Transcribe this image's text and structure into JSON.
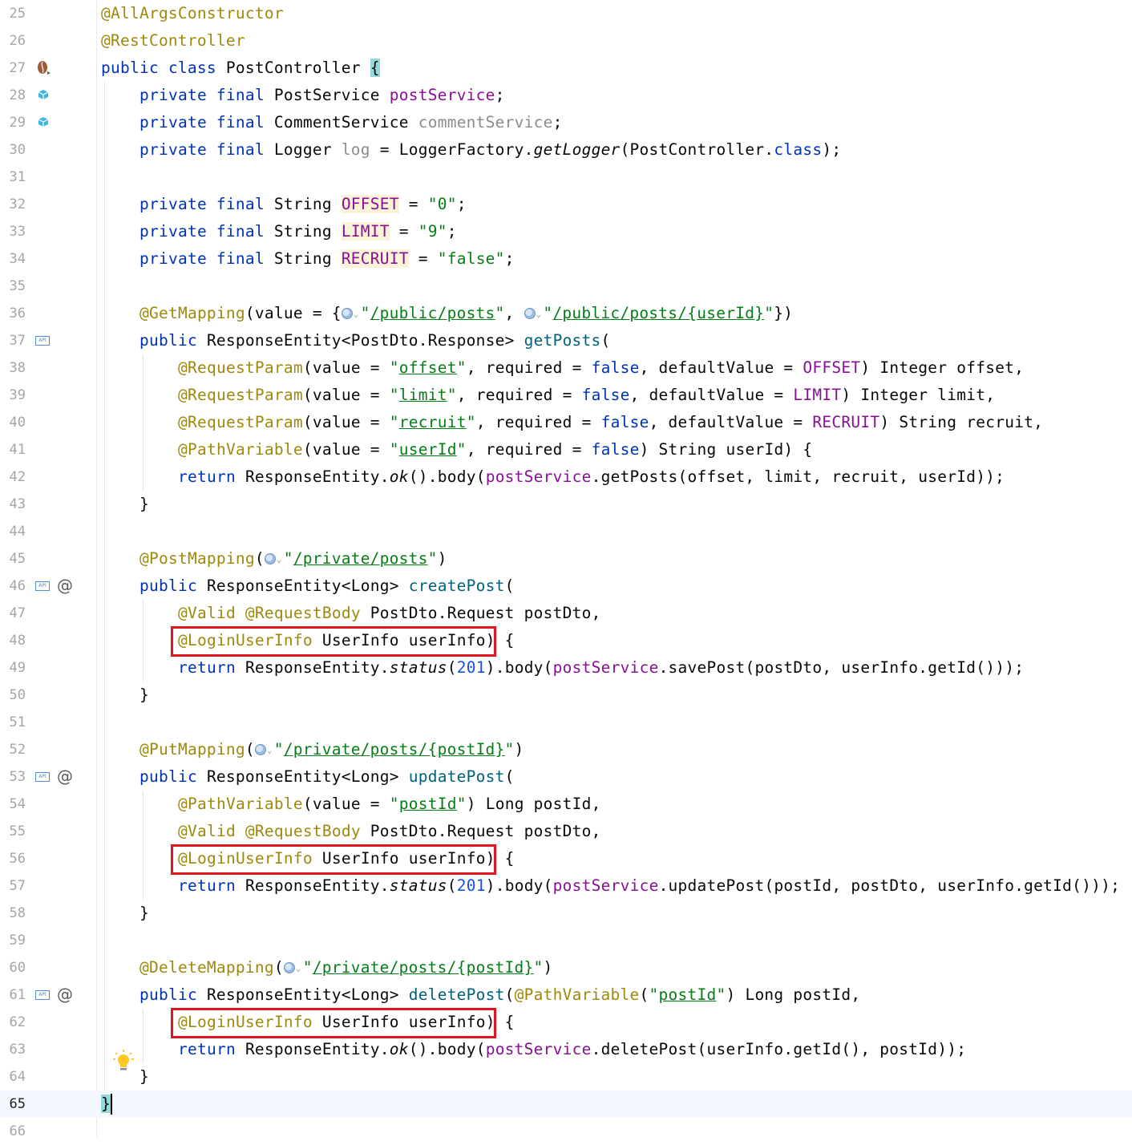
{
  "editor": {
    "lines": [
      {
        "num": "25",
        "indent": 0,
        "tokens": [
          {
            "t": "@AllArgsConstructor",
            "c": "anno"
          }
        ]
      },
      {
        "num": "26",
        "indent": 0,
        "tokens": [
          {
            "t": "@RestController",
            "c": "anno"
          }
        ]
      },
      {
        "num": "27",
        "indent": 0,
        "gutter": "coffee-icon",
        "tokens": [
          {
            "t": "public ",
            "c": "kw"
          },
          {
            "t": "class ",
            "c": "kw"
          },
          {
            "t": "PostController "
          },
          {
            "t": "{",
            "c": "bracehl"
          }
        ]
      },
      {
        "num": "28",
        "indent": 1,
        "gutter": "bean-icon",
        "tokens": [
          {
            "t": "private ",
            "c": "kw"
          },
          {
            "t": "final ",
            "c": "kw"
          },
          {
            "t": "PostService "
          },
          {
            "t": "postService",
            "c": "field"
          },
          {
            "t": ";"
          }
        ]
      },
      {
        "num": "29",
        "indent": 1,
        "gutter": "bean-icon",
        "tokens": [
          {
            "t": "private ",
            "c": "kw"
          },
          {
            "t": "final ",
            "c": "kw"
          },
          {
            "t": "CommentService "
          },
          {
            "t": "commentService",
            "c": "gray"
          },
          {
            "t": ";"
          }
        ]
      },
      {
        "num": "30",
        "indent": 1,
        "tokens": [
          {
            "t": "private ",
            "c": "kw"
          },
          {
            "t": "final ",
            "c": "kw"
          },
          {
            "t": "Logger "
          },
          {
            "t": "log",
            "c": "gray"
          },
          {
            "t": " = LoggerFactory."
          },
          {
            "t": "getLogger",
            "c": "it"
          },
          {
            "t": "(PostController."
          },
          {
            "t": "class",
            "c": "kw"
          },
          {
            "t": ");"
          }
        ]
      },
      {
        "num": "31",
        "indent": 0,
        "tokens": []
      },
      {
        "num": "32",
        "indent": 1,
        "tokens": [
          {
            "t": "private ",
            "c": "kw"
          },
          {
            "t": "final ",
            "c": "kw"
          },
          {
            "t": "String "
          },
          {
            "t": "OFFSET",
            "c": "field hl"
          },
          {
            "t": " = "
          },
          {
            "t": "\"0\"",
            "c": "str"
          },
          {
            "t": ";"
          }
        ]
      },
      {
        "num": "33",
        "indent": 1,
        "tokens": [
          {
            "t": "private ",
            "c": "kw"
          },
          {
            "t": "final ",
            "c": "kw"
          },
          {
            "t": "String "
          },
          {
            "t": "LIMIT",
            "c": "field hl"
          },
          {
            "t": " = "
          },
          {
            "t": "\"9\"",
            "c": "str"
          },
          {
            "t": ";"
          }
        ]
      },
      {
        "num": "34",
        "indent": 1,
        "tokens": [
          {
            "t": "private ",
            "c": "kw"
          },
          {
            "t": "final ",
            "c": "kw"
          },
          {
            "t": "String "
          },
          {
            "t": "RECRUIT",
            "c": "field hl"
          },
          {
            "t": " = "
          },
          {
            "t": "\"false\"",
            "c": "str"
          },
          {
            "t": ";"
          }
        ]
      },
      {
        "num": "35",
        "indent": 0,
        "tokens": []
      },
      {
        "num": "36",
        "indent": 1,
        "tokens": [
          {
            "t": "@GetMapping",
            "c": "anno"
          },
          {
            "t": "(value = {"
          },
          {
            "globe": true
          },
          {
            "t": "\"",
            "c": "str"
          },
          {
            "t": "/public/posts",
            "c": "url"
          },
          {
            "t": "\"",
            "c": "str"
          },
          {
            "t": ", "
          },
          {
            "globe": true
          },
          {
            "t": "\"",
            "c": "str"
          },
          {
            "t": "/public/posts/{userId}",
            "c": "url"
          },
          {
            "t": "\"",
            "c": "str"
          },
          {
            "t": "})"
          }
        ]
      },
      {
        "num": "37",
        "indent": 1,
        "gutter": "api-icon",
        "tokens": [
          {
            "t": "public ",
            "c": "kw"
          },
          {
            "t": "ResponseEntity<PostDto.Response> "
          },
          {
            "t": "getPosts",
            "c": "method"
          },
          {
            "t": "("
          }
        ]
      },
      {
        "num": "38",
        "indent": 2,
        "tokens": [
          {
            "t": "@RequestParam",
            "c": "anno"
          },
          {
            "t": "(value = "
          },
          {
            "t": "\"",
            "c": "str"
          },
          {
            "t": "offset",
            "c": "url"
          },
          {
            "t": "\"",
            "c": "str"
          },
          {
            "t": ", required = "
          },
          {
            "t": "false",
            "c": "kw"
          },
          {
            "t": ", defaultValue = "
          },
          {
            "t": "OFFSET",
            "c": "field"
          },
          {
            "t": ") Integer offset,"
          }
        ]
      },
      {
        "num": "39",
        "indent": 2,
        "tokens": [
          {
            "t": "@RequestParam",
            "c": "anno"
          },
          {
            "t": "(value = "
          },
          {
            "t": "\"",
            "c": "str"
          },
          {
            "t": "limit",
            "c": "url"
          },
          {
            "t": "\"",
            "c": "str"
          },
          {
            "t": ", required = "
          },
          {
            "t": "false",
            "c": "kw"
          },
          {
            "t": ", defaultValue = "
          },
          {
            "t": "LIMIT",
            "c": "field"
          },
          {
            "t": ") Integer limit,"
          }
        ]
      },
      {
        "num": "40",
        "indent": 2,
        "tokens": [
          {
            "t": "@RequestParam",
            "c": "anno"
          },
          {
            "t": "(value = "
          },
          {
            "t": "\"",
            "c": "str"
          },
          {
            "t": "recruit",
            "c": "url"
          },
          {
            "t": "\"",
            "c": "str"
          },
          {
            "t": ", required = "
          },
          {
            "t": "false",
            "c": "kw"
          },
          {
            "t": ", defaultValue = "
          },
          {
            "t": "RECRUIT",
            "c": "field"
          },
          {
            "t": ") String recruit,"
          }
        ]
      },
      {
        "num": "41",
        "indent": 2,
        "tokens": [
          {
            "t": "@PathVariable",
            "c": "anno"
          },
          {
            "t": "(value = "
          },
          {
            "t": "\"",
            "c": "str"
          },
          {
            "t": "userId",
            "c": "url"
          },
          {
            "t": "\"",
            "c": "str"
          },
          {
            "t": ", required = "
          },
          {
            "t": "false",
            "c": "kw"
          },
          {
            "t": ") String userId) {"
          }
        ]
      },
      {
        "num": "42",
        "indent": 2,
        "tokens": [
          {
            "t": "return ",
            "c": "kw"
          },
          {
            "t": "ResponseEntity."
          },
          {
            "t": "ok",
            "c": "it"
          },
          {
            "t": "().body("
          },
          {
            "t": "postService",
            "c": "field"
          },
          {
            "t": ".getPosts(offset, limit, recruit, userId));"
          }
        ]
      },
      {
        "num": "43",
        "indent": 1,
        "tokens": [
          {
            "t": "}"
          }
        ]
      },
      {
        "num": "44",
        "indent": 0,
        "tokens": []
      },
      {
        "num": "45",
        "indent": 1,
        "tokens": [
          {
            "t": "@PostMapping",
            "c": "anno"
          },
          {
            "t": "("
          },
          {
            "globe": true
          },
          {
            "t": "\"",
            "c": "str"
          },
          {
            "t": "/private/posts",
            "c": "url"
          },
          {
            "t": "\"",
            "c": "str"
          },
          {
            "t": ")"
          }
        ]
      },
      {
        "num": "46",
        "indent": 1,
        "gutter": "api-at",
        "tokens": [
          {
            "t": "public ",
            "c": "kw"
          },
          {
            "t": "ResponseEntity<Long> "
          },
          {
            "t": "createPost",
            "c": "method"
          },
          {
            "t": "("
          }
        ]
      },
      {
        "num": "47",
        "indent": 2,
        "tokens": [
          {
            "t": "@Valid @RequestBody",
            "c": "anno"
          },
          {
            "t": " PostDto.Request postDto,"
          }
        ]
      },
      {
        "num": "48",
        "indent": 2,
        "tokens": [
          {
            "t": "@LoginUserInfo",
            "c": "anno"
          },
          {
            "t": " UserInfo userInfo) {"
          }
        ]
      },
      {
        "num": "49",
        "indent": 2,
        "tokens": [
          {
            "t": "return ",
            "c": "kw"
          },
          {
            "t": "ResponseEntity."
          },
          {
            "t": "status",
            "c": "it"
          },
          {
            "t": "("
          },
          {
            "t": "201",
            "c": "num"
          },
          {
            "t": ").body("
          },
          {
            "t": "postService",
            "c": "field"
          },
          {
            "t": ".savePost(postDto, userInfo.getId()));"
          }
        ]
      },
      {
        "num": "50",
        "indent": 1,
        "tokens": [
          {
            "t": "}"
          }
        ]
      },
      {
        "num": "51",
        "indent": 0,
        "tokens": []
      },
      {
        "num": "52",
        "indent": 1,
        "tokens": [
          {
            "t": "@PutMapping",
            "c": "anno"
          },
          {
            "t": "("
          },
          {
            "globe": true
          },
          {
            "t": "\"",
            "c": "str"
          },
          {
            "t": "/private/posts/{postId}",
            "c": "url"
          },
          {
            "t": "\"",
            "c": "str"
          },
          {
            "t": ")"
          }
        ]
      },
      {
        "num": "53",
        "indent": 1,
        "gutter": "api-at",
        "tokens": [
          {
            "t": "public ",
            "c": "kw"
          },
          {
            "t": "ResponseEntity<Long> "
          },
          {
            "t": "updatePost",
            "c": "method"
          },
          {
            "t": "("
          }
        ]
      },
      {
        "num": "54",
        "indent": 2,
        "tokens": [
          {
            "t": "@PathVariable",
            "c": "anno"
          },
          {
            "t": "(value = "
          },
          {
            "t": "\"",
            "c": "str"
          },
          {
            "t": "postId",
            "c": "url"
          },
          {
            "t": "\"",
            "c": "str"
          },
          {
            "t": ") Long postId,"
          }
        ]
      },
      {
        "num": "55",
        "indent": 2,
        "tokens": [
          {
            "t": "@Valid @RequestBody",
            "c": "anno"
          },
          {
            "t": " PostDto.Request postDto,"
          }
        ]
      },
      {
        "num": "56",
        "indent": 2,
        "tokens": [
          {
            "t": "@LoginUserInfo",
            "c": "anno"
          },
          {
            "t": " UserInfo userInfo) {"
          }
        ]
      },
      {
        "num": "57",
        "indent": 2,
        "tokens": [
          {
            "t": "return ",
            "c": "kw"
          },
          {
            "t": "ResponseEntity."
          },
          {
            "t": "status",
            "c": "it"
          },
          {
            "t": "("
          },
          {
            "t": "201",
            "c": "num"
          },
          {
            "t": ").body("
          },
          {
            "t": "postService",
            "c": "field"
          },
          {
            "t": ".updatePost(postId, postDto, userInfo.getId()));"
          }
        ]
      },
      {
        "num": "58",
        "indent": 1,
        "tokens": [
          {
            "t": "}"
          }
        ]
      },
      {
        "num": "59",
        "indent": 0,
        "tokens": []
      },
      {
        "num": "60",
        "indent": 1,
        "tokens": [
          {
            "t": "@DeleteMapping",
            "c": "anno"
          },
          {
            "t": "("
          },
          {
            "globe": true
          },
          {
            "t": "\"",
            "c": "str"
          },
          {
            "t": "/private/posts/{postId}",
            "c": "url"
          },
          {
            "t": "\"",
            "c": "str"
          },
          {
            "t": ")"
          }
        ]
      },
      {
        "num": "61",
        "indent": 1,
        "gutter": "api-at",
        "tokens": [
          {
            "t": "public ",
            "c": "kw"
          },
          {
            "t": "ResponseEntity<Long> "
          },
          {
            "t": "deletePost",
            "c": "method"
          },
          {
            "t": "("
          },
          {
            "t": "@PathVariable",
            "c": "anno"
          },
          {
            "t": "("
          },
          {
            "t": "\"",
            "c": "str"
          },
          {
            "t": "postId",
            "c": "url"
          },
          {
            "t": "\"",
            "c": "str"
          },
          {
            "t": ") Long postId,"
          }
        ]
      },
      {
        "num": "62",
        "indent": 2,
        "tokens": [
          {
            "t": "@LoginUserInfo",
            "c": "anno"
          },
          {
            "t": " UserInfo userInfo) {"
          }
        ]
      },
      {
        "num": "63",
        "indent": 2,
        "tokens": [
          {
            "t": "return ",
            "c": "kw"
          },
          {
            "t": "ResponseEntity."
          },
          {
            "t": "ok",
            "c": "it"
          },
          {
            "t": "().body("
          },
          {
            "t": "postService",
            "c": "field"
          },
          {
            "t": ".deletePost(userInfo.getId(), postId));"
          }
        ]
      },
      {
        "num": "64",
        "indent": 1,
        "gutter": "bulb-icon",
        "tokens": [
          {
            "t": "}"
          }
        ]
      },
      {
        "num": "65",
        "indent": 0,
        "current": true,
        "tokens": [
          {
            "t": "}",
            "c": "bracehl"
          }
        ]
      },
      {
        "num": "66",
        "indent": 0,
        "tokens": []
      }
    ],
    "highlighted_lines": [
      "48",
      "56",
      "62"
    ],
    "colors": {
      "keyword": "#0033b3",
      "annotation": "#9e880d",
      "field": "#871094",
      "string": "#067d17",
      "number": "#1750eb",
      "method": "#00627a",
      "highlight_box": "#e0141e"
    }
  }
}
